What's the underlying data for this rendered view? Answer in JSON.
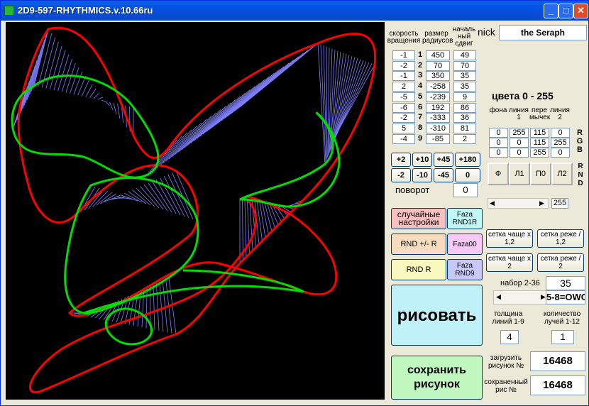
{
  "window": {
    "title": "2D9-597-RHYTHMICS.v.10.66ru",
    "minimize": "_",
    "maximize": "□",
    "close": "✕"
  },
  "headers": {
    "speed": "скорость вращения",
    "radius": "размер радиусов",
    "shift": "началь ный сдвиг"
  },
  "nick": {
    "label": "nick",
    "value": "the Seraph"
  },
  "rows": [
    {
      "n": "1",
      "speed": "-1",
      "radius": "450",
      "shift": "49"
    },
    {
      "n": "2",
      "speed": "-2",
      "radius": "70",
      "shift": "70"
    },
    {
      "n": "3",
      "speed": "-1",
      "radius": "350",
      "shift": "35"
    },
    {
      "n": "4",
      "speed": "2",
      "radius": "-258",
      "shift": "35"
    },
    {
      "n": "5",
      "speed": "-5",
      "radius": "-239",
      "shift": "9"
    },
    {
      "n": "6",
      "speed": "-6",
      "radius": "192",
      "shift": "86"
    },
    {
      "n": "7",
      "speed": "-2",
      "radius": "-333",
      "shift": "36"
    },
    {
      "n": "8",
      "speed": "5",
      "radius": "-310",
      "shift": "81"
    },
    {
      "n": "9",
      "speed": "-4",
      "radius": "-85",
      "shift": "2"
    }
  ],
  "colors": {
    "title": "цвета 0 - 255",
    "headers": [
      "фона",
      "линия 1",
      "пере мычек",
      "линия 2"
    ],
    "rgb": [
      [
        "0",
        "255",
        "115",
        "0"
      ],
      [
        "0",
        "0",
        "115",
        "255"
      ],
      [
        "0",
        "0",
        "255",
        "0"
      ]
    ],
    "rgb_label": [
      "R",
      "G",
      "B"
    ],
    "rnd_label": [
      "R",
      "N",
      "D"
    ],
    "toggles": [
      "Ф",
      "Л1",
      "П0",
      "Л2"
    ],
    "scroll_value": "255"
  },
  "rotate": {
    "buttons": [
      "+2",
      "+10",
      "+45",
      "+180",
      "-2",
      "-10",
      "-45",
      "0"
    ],
    "label": "поворот",
    "value": "0"
  },
  "actions": {
    "random_settings": "случайные настройки",
    "faza_rnd1r": "Faza RND1R",
    "rnd_pm_r": "RND +/- R",
    "faza00": "Faza00",
    "rnd_r": "RND R",
    "faza_rnd9": "Faza RND9",
    "draw": "рисовать",
    "save": "сохранить рисунок"
  },
  "grid": {
    "denser_12": "сетка чаще x 1,2",
    "sparser_12": "сетка реже / 1,2",
    "denser_2": "сетка чаще x 2",
    "sparser_2": "сетка реже / 2"
  },
  "set": {
    "label": "набор 2-36",
    "value": "35",
    "formula": "5-8=OWC"
  },
  "thickness": {
    "label": "толщина линий 1-9",
    "value": "4"
  },
  "rays": {
    "label": "количество лучей 1-12",
    "value": "1"
  },
  "load": {
    "label": "загрузить рисунок №",
    "value": "16468"
  },
  "saved": {
    "label": "сохраненный рис №",
    "value": "16468"
  },
  "palette": {
    "red": "#ff0000",
    "green": "#00ff00",
    "blue": "#8080ff",
    "draw_bg": "#c0f0f8",
    "save_bg": "#c0f8c0",
    "pink": "#f8c0c0",
    "cyan": "#c0f8f8",
    "peach": "#f8dcc0",
    "yellow": "#f8f8c0",
    "lavender": "#c8c8f8"
  }
}
